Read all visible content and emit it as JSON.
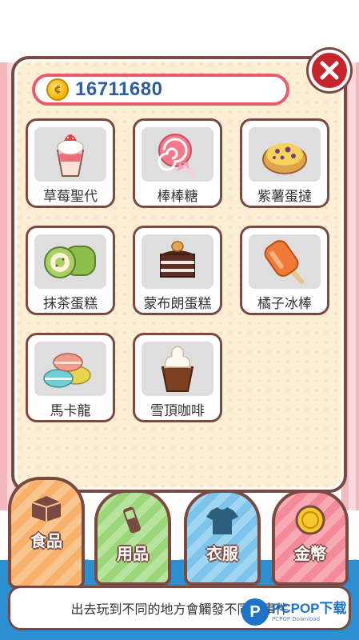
{
  "coins": {
    "value": "16711680",
    "icon": "coin-icon"
  },
  "close": {
    "icon": "close-icon"
  },
  "items": [
    {
      "label": "草莓聖代",
      "icon": "strawberry-sundae-icon"
    },
    {
      "label": "棒棒糖",
      "icon": "lollipop-icon"
    },
    {
      "label": "紫薯蛋撻",
      "icon": "purple-potato-tart-icon"
    },
    {
      "label": "抹茶蛋糕",
      "icon": "matcha-roll-cake-icon"
    },
    {
      "label": "蒙布朗蛋糕",
      "icon": "mont-blanc-cake-icon"
    },
    {
      "label": "橘子冰棒",
      "icon": "orange-popsicle-icon"
    },
    {
      "label": "馬卡龍",
      "icon": "macaron-icon"
    },
    {
      "label": "雪頂咖啡",
      "icon": "coffee-float-icon"
    }
  ],
  "tabs": [
    {
      "label": "食品",
      "icon": "food-box-icon",
      "selected": true
    },
    {
      "label": "用品",
      "icon": "supplies-icon",
      "selected": false
    },
    {
      "label": "衣服",
      "icon": "shirt-icon",
      "selected": false
    },
    {
      "label": "金幣",
      "icon": "coin-icon",
      "selected": false
    }
  ],
  "message": "出去玩到不同的地方會觸發不同的事件",
  "watermark": {
    "logo": "P",
    "main": "PCPOP下载",
    "sub": "PCPOP Download"
  },
  "colors": {
    "panel": "#fdefd6",
    "border": "#7a4a42",
    "accent_red": "#c8242c",
    "coin_text": "#2d5f9c",
    "sea_blue": "#2b8fd1"
  }
}
